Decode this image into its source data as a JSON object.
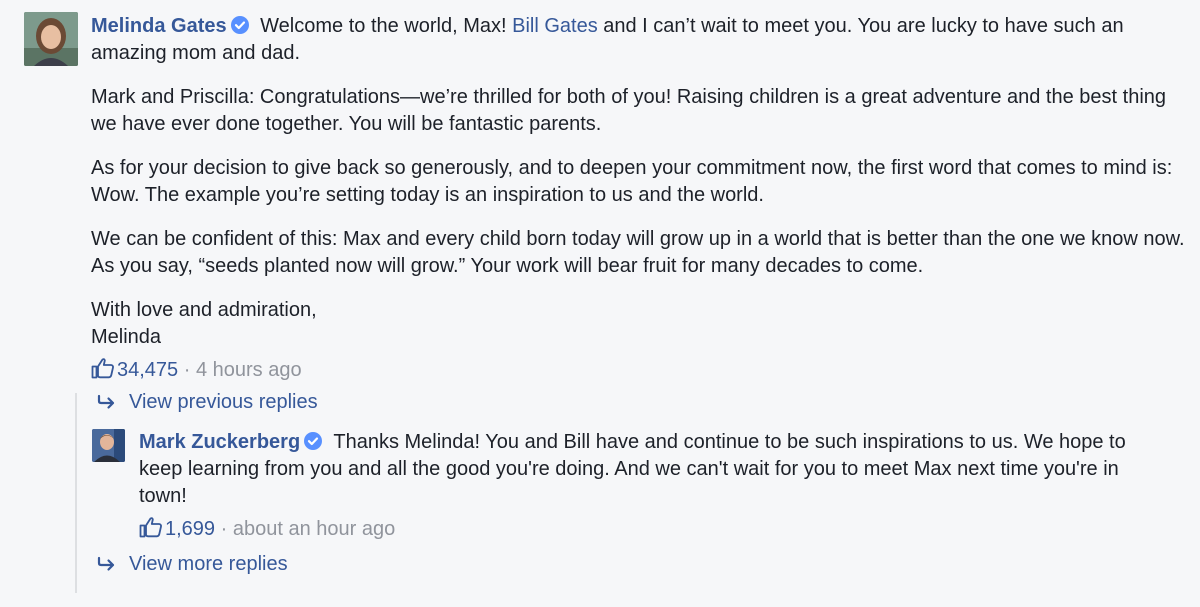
{
  "comment": {
    "author": "Melinda Gates",
    "intro_text": " Welcome to the world, Max! ",
    "mention": "Bill Gates",
    "intro_rest": " and I can’t wait to meet you. You are lucky to have such an amazing mom and dad.",
    "paragraphs": [
      "Mark and Priscilla: Congratulations—we’re thrilled for both of you! Raising children is a great adventure and the best thing we have ever done together. You will be fantastic parents.",
      "As for your decision to give back so generously, and to deepen your commitment now, the first word that comes to mind is: Wow. The example you’re setting today is an inspiration to us and the world.",
      "We can be confident of this: Max and every child born today will grow up in a world that is better than the one we know now. As you say, “seeds planted now will grow.” Your work will bear fruit for many decades to come."
    ],
    "signoff_line1": "With love and admiration,",
    "signoff_line2": "Melinda",
    "like_count": "34,475",
    "separator": " · ",
    "timestamp": "4 hours ago"
  },
  "view_previous_replies": "View previous replies",
  "reply": {
    "author": "Mark Zuckerberg",
    "text": " Thanks Melinda! You and Bill have and continue to be such inspirations to us. We hope to keep learning from you and all the good you're doing. And we can't wait for you to meet Max next time you're in town!",
    "like_count": "1,699",
    "separator": " · ",
    "timestamp": "about an hour ago"
  },
  "view_more_replies": "View more replies",
  "colors": {
    "link": "#365899",
    "verified_badge": "#5890ff",
    "meta_gray": "#90949c",
    "background": "#f6f7f9"
  },
  "icons": [
    "verified-badge-icon",
    "like-thumb-icon",
    "reply-arrow-icon"
  ]
}
